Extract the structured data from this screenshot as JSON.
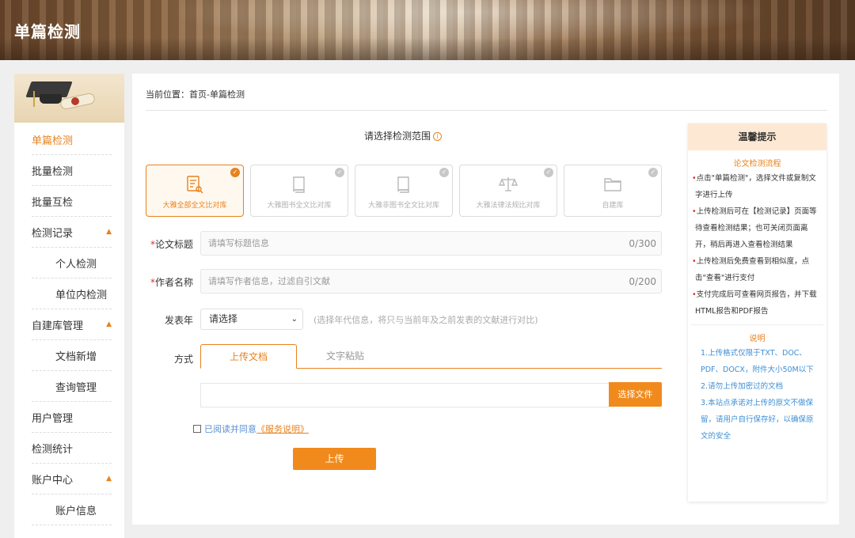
{
  "header": {
    "title": "单篇检测"
  },
  "sidebar": {
    "items": [
      {
        "label": "单篇检测",
        "active": true,
        "arrow": ""
      },
      {
        "label": "批量检测",
        "arrow": ""
      },
      {
        "label": "批量互检",
        "arrow": ""
      },
      {
        "label": "检测记录",
        "arrow": "▲"
      },
      {
        "label": "个人检测",
        "sub": true
      },
      {
        "label": "单位内检测",
        "sub": true
      },
      {
        "label": "自建库管理",
        "arrow": "▲"
      },
      {
        "label": "文档新增",
        "sub": true
      },
      {
        "label": "查询管理",
        "sub": true
      },
      {
        "label": "用户管理",
        "arrow": ""
      },
      {
        "label": "检测统计",
        "arrow": ""
      },
      {
        "label": "账户中心",
        "arrow": "▲"
      },
      {
        "label": "账户信息",
        "sub": true
      }
    ]
  },
  "main": {
    "breadcrumb": "当前位置：首页-单篇检测",
    "scope_title": "请选择检测范围",
    "scope_info_icon": "i",
    "libraries": [
      {
        "label": "大雅全部全文比对库",
        "icon": "document-search-icon",
        "selected": true
      },
      {
        "label": "大雅图书全文比对库",
        "icon": "book-icon",
        "selected": false
      },
      {
        "label": "大雅非图书全文比对库",
        "icon": "book-icon",
        "selected": false
      },
      {
        "label": "大雅法律法规比对库",
        "icon": "scales-icon",
        "selected": false
      },
      {
        "label": "自建库",
        "icon": "folder-icon",
        "selected": false
      }
    ],
    "check_glyph": "✓",
    "title_field": {
      "required": "*",
      "label": "论文标题",
      "placeholder": "请填写标题信息",
      "counter": "0/300"
    },
    "author_field": {
      "required": "*",
      "label": "作者名称",
      "placeholder": "请填写作者信息，过滤自引文献",
      "counter": "0/200"
    },
    "year_field": {
      "label": "发表年",
      "value": "请选择",
      "caret": "⌄",
      "hint": "(选择年代信息，将只与当前年及之前发表的文献进行对比)"
    },
    "method": {
      "label": "方式",
      "tabs": [
        "上传文档",
        "文字粘贴"
      ],
      "active_tab": 0
    },
    "choose_file": "选择文件",
    "agree_text": "已阅读并同意",
    "agree_link": "《服务说明》",
    "upload_button": "上传"
  },
  "tips": {
    "title": "温馨提示",
    "process_title": "论文检测流程",
    "process_items": [
      "点击\"单篇检测\"，选择文件或复制文字进行上传",
      "上传检测后可在【检测记录】页面等待查看检测结果；也可关闭页面离开，稍后再进入查看检测结果",
      "上传检测后免费查看到相似度，点击\"查看\"进行支付",
      "支付完成后可查看网页报告，并下载HTML报告和PDF报告"
    ],
    "bullet": "•",
    "note_title": "说明",
    "note_items": [
      "1.上传格式仅限于TXT、DOC、PDF、DOCX，附件大小50M以下",
      "2.请勿上传加密过的文档",
      "3.本站点承诺对上传的原文不做保留，请用户自行保存好，以确保原文的安全"
    ]
  },
  "colors": {
    "accent": "#e8821e",
    "button": "#f18a1d",
    "required": "#e0322b",
    "link_blue": "#3d8fd6"
  }
}
